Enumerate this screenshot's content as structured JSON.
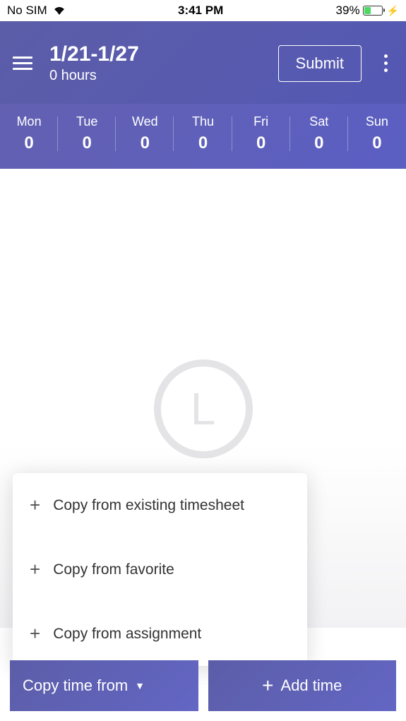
{
  "statusBar": {
    "sim": "No SIM",
    "time": "3:41 PM",
    "battery": "39%"
  },
  "header": {
    "title": "1/21-1/27",
    "subtitle": "0 hours",
    "submitLabel": "Submit"
  },
  "days": [
    {
      "name": "Mon",
      "value": "0"
    },
    {
      "name": "Tue",
      "value": "0"
    },
    {
      "name": "Wed",
      "value": "0"
    },
    {
      "name": "Thu",
      "value": "0"
    },
    {
      "name": "Fri",
      "value": "0"
    },
    {
      "name": "Sat",
      "value": "0"
    },
    {
      "name": "Sun",
      "value": "0"
    }
  ],
  "emptyIcon": "L",
  "popup": {
    "items": [
      "Copy from existing timesheet",
      "Copy from favorite",
      "Copy from assignment"
    ]
  },
  "bottomBar": {
    "copyLabel": "Copy time from",
    "addLabel": "Add time"
  }
}
